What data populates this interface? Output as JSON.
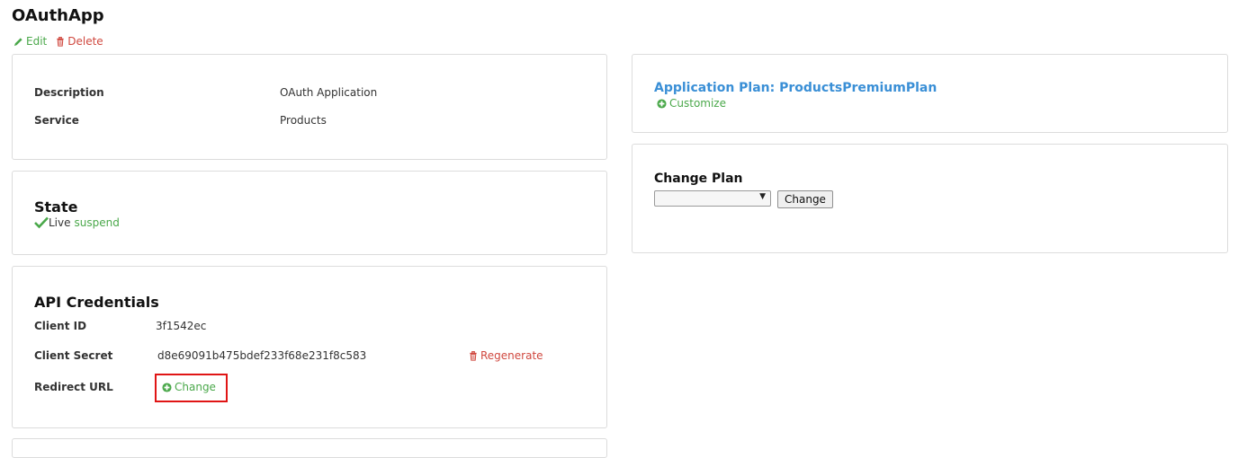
{
  "page": {
    "title": "OAuthApp",
    "edit_label": "Edit",
    "delete_label": "Delete"
  },
  "details": {
    "description_label": "Description",
    "description_value": "OAuth Application",
    "service_label": "Service",
    "service_value": "Products"
  },
  "state": {
    "title": "State",
    "status": "Live",
    "suspend_label": "suspend"
  },
  "credentials": {
    "title": "API Credentials",
    "client_id_label": "Client ID",
    "client_id_value": "3f1542ec",
    "client_secret_label": "Client Secret",
    "client_secret_value": "d8e69091b475bdef233f68e231f8c583",
    "regenerate_label": "Regenerate",
    "redirect_url_label": "Redirect URL",
    "redirect_change_label": "Change"
  },
  "plan": {
    "title": "Application Plan: ProductsPremiumPlan",
    "customize_label": "Customize"
  },
  "change_plan": {
    "title": "Change Plan",
    "selected_option": "",
    "button_label": "Change"
  },
  "colors": {
    "link_blue": "#3a8fd6",
    "action_green": "#4aa84a",
    "danger_red": "#d0483f",
    "highlight_red": "#e01515"
  }
}
